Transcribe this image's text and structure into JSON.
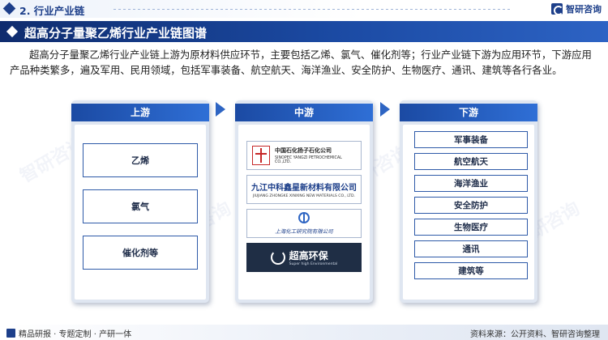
{
  "header": {
    "section": "2. 行业产业链",
    "brand": "智研咨询"
  },
  "title": "超高分子量聚乙烯行业产业链图谱",
  "description": "超高分子量聚乙烯行业产业链上游为原材料供应环节，主要包括乙烯、氯气、催化剂等；行业产业链下游为应用环节，下游应用产品种类繁多，遍及军用、民用领域，包括军事装备、航空航天、海洋渔业、安全防护、生物医疗、通讯、建筑等各行各业。",
  "upstream": {
    "label": "上游",
    "items": [
      "乙烯",
      "氯气",
      "催化剂等"
    ]
  },
  "midstream": {
    "label": "中游",
    "companies": [
      {
        "cn": "中国石化扬子石化公司",
        "en": "SINOPEC YANGZI PETROCHEMICAL CO.,LTD.",
        "sub": "中国石化"
      },
      {
        "cn": "九江中科鑫星新材料有限公司",
        "en": "JIUJIANG ZHONGKE XINXING NEW MATERIALS CO., LTD."
      },
      {
        "cn": "上海化工研究院有限公司"
      },
      {
        "cn": "超高环保",
        "en": "Super high Environmental"
      }
    ]
  },
  "downstream": {
    "label": "下游",
    "items": [
      "军事装备",
      "航空航天",
      "海洋渔业",
      "安全防护",
      "生物医疗",
      "通讯",
      "建筑等"
    ]
  },
  "footer": {
    "left": "精品研报 · 专题定制 · 产研一体",
    "source": "资料来源：公开资料、智研咨询整理"
  },
  "watermark": "智研咨询",
  "colors": {
    "primary": "#1d3f8a",
    "accent": "#2e65c3"
  }
}
